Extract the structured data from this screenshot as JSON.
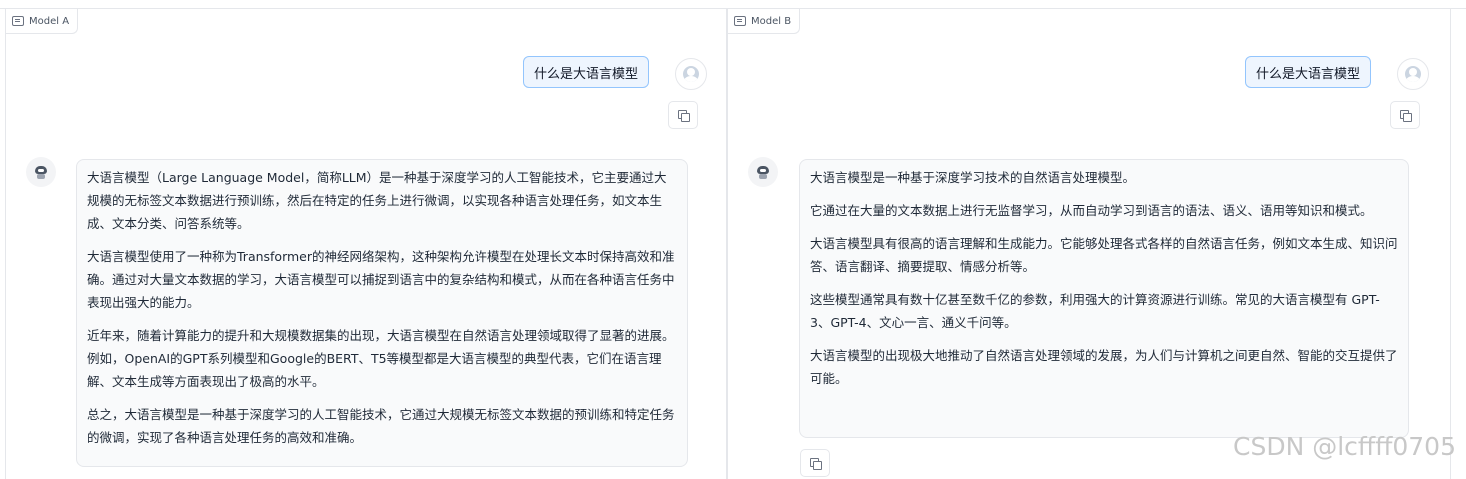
{
  "model_a": {
    "label": "Model A",
    "user_message": "什么是大语言模型",
    "response_paragraphs": [
      "大语言模型（Large Language Model，简称LLM）是一种基于深度学习的人工智能技术，它主要通过大规模的无标签文本数据进行预训练，然后在特定的任务上进行微调，以实现各种语言处理任务，如文本生成、文本分类、问答系统等。",
      "大语言模型使用了一种称为Transformer的神经网络架构，这种架构允许模型在处理长文本时保持高效和准确。通过对大量文本数据的学习，大语言模型可以捕捉到语言中的复杂结构和模式，从而在各种语言任务中表现出强大的能力。",
      "近年来，随着计算能力的提升和大规模数据集的出现，大语言模型在自然语言处理领域取得了显著的进展。例如，OpenAI的GPT系列模型和Google的BERT、T5等模型都是大语言模型的典型代表，它们在语言理解、文本生成等方面表现出了极高的水平。",
      "总之，大语言模型是一种基于深度学习的人工智能技术，它通过大规模无标签文本数据的预训练和特定任务的微调，实现了各种语言处理任务的高效和准确。"
    ]
  },
  "model_b": {
    "label": "Model B",
    "user_message": "什么是大语言模型",
    "response_paragraphs": [
      "大语言模型是一种基于深度学习技术的自然语言处理模型。",
      "它通过在大量的文本数据上进行无监督学习，从而自动学习到语言的语法、语义、语用等知识和模式。",
      "大语言模型具有很高的语言理解和生成能力。它能够处理各式各样的自然语言任务，例如文本生成、知识问答、语言翻译、摘要提取、情感分析等。",
      "这些模型通常具有数十亿甚至数千亿的参数，利用强大的计算资源进行训练。常见的大语言模型有 GPT-3、GPT-4、文心一言、通义千问等。",
      "大语言模型的出现极大地推动了自然语言处理领域的发展，为人们与计算机之间更自然、智能的交互提供了可能。"
    ]
  },
  "watermark": "CSDN @lcffff0705"
}
